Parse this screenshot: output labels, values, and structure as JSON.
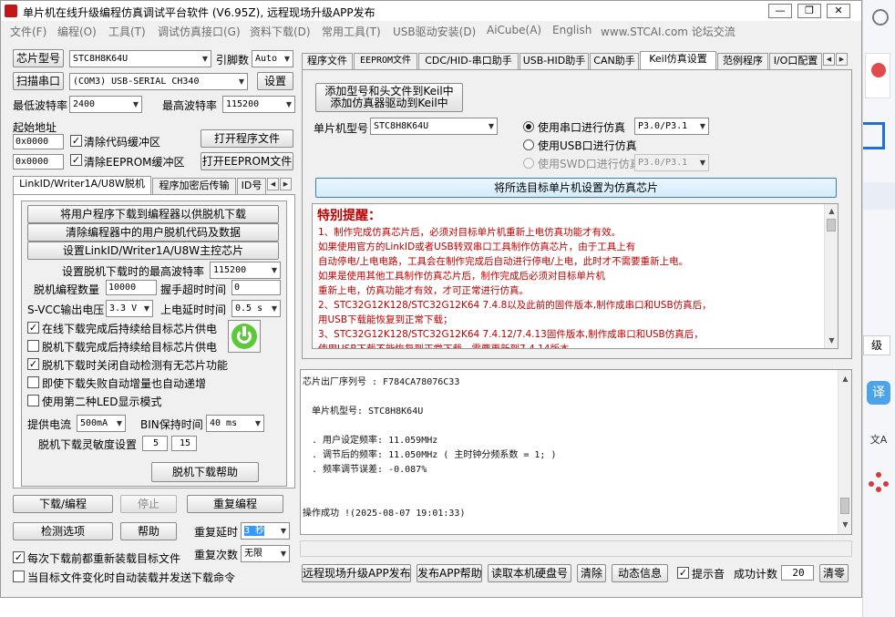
{
  "window": {
    "title": "单片机在线升级编程仿真调试平台软件 (V6.95Z), 远程现场升级APP发布",
    "controls": [
      "—",
      "❐",
      "✕"
    ]
  },
  "menu": [
    "文件(F)",
    "编程(O)",
    "工具(T)",
    "调试仿真接口(G)",
    "资料下载(D)",
    "常用工具(T)",
    "USB驱动安装(D)",
    "AiCube(A)",
    "English",
    "www.STCAI.com 论坛交流"
  ],
  "left": {
    "mcu_type_btn": "芯片型号",
    "mcu_type_value": "STC8H8K64U",
    "pins_label": "引脚数",
    "pins_value": "Auto",
    "scan_port_btn": "扫描串口",
    "port_value": "(COM3) USB-SERIAL CH340",
    "settings_btn": "设置",
    "min_baud_label": "最低波特率",
    "min_baud_value": "2400",
    "max_baud_label": "最高波特率",
    "max_baud_value": "115200",
    "start_addr_label": "起始地址",
    "addr1": "0x0000",
    "clear_code_label": "清除代码缓冲区",
    "open_program_btn": "打开程序文件",
    "addr2": "0x0000",
    "clear_eeprom_label": "清除EEPROM缓冲区",
    "open_eeprom_btn": "打开EEPROM文件",
    "tabs": [
      "LinkID/Writer1A/U8W脱机",
      "程序加密后传输",
      "ID号"
    ],
    "offline": {
      "btn1": "将用户程序下载到编程器以供脱机下载",
      "btn2": "清除编程器中的用户脱机代码及数据",
      "btn3": "设置LinkID/Writer1A/U8W主控芯片",
      "max_baud_label": "设置脱机下载时的最高波特率",
      "max_baud_value": "115200",
      "count_label": "脱机编程数量",
      "count_value": "10000",
      "handshake_label": "握手超时时间",
      "handshake_value": "0",
      "svcc_label": "S-VCC输出电压",
      "svcc_value": "3.3 V",
      "power_delay_label": "上电延时时间",
      "power_delay_value": "0.5 s",
      "chk1": "在线下载完成后持续给目标芯片供电",
      "chk2": "脱机下载完成后持续给目标芯片供电",
      "chk3": "脱机下载时关闭自动检测有无芯片功能",
      "chk4": "即使下载失败自动增量也自动递增",
      "chk5": "使用第二种LED显示模式",
      "current_label": "提供电流",
      "current_value": "500mA",
      "bin_hold_label": "BIN保持时间",
      "bin_hold_value": "40 ms",
      "sensitivity_label": "脱机下载灵敏度设置",
      "sens1": "5",
      "sens2": "15",
      "help_btn": "脱机下载帮助"
    },
    "download_btn": "下载/编程",
    "stop_btn": "停止",
    "reprogram_btn": "重复编程",
    "check_btn": "检测选项",
    "help_btn": "帮助",
    "repeat_delay_label": "重复延时",
    "repeat_delay_value": "3 秒",
    "repeat_count_label": "重复次数",
    "repeat_count_value": "无限",
    "reload_label": "每次下载前都重新装载目标文件",
    "auto_reload_label": "当目标文件变化时自动装载并发送下载命令"
  },
  "right": {
    "tabs": [
      "程序文件",
      "EEPROM文件",
      "CDC/HID-串口助手",
      "USB-HID助手",
      "CAN助手",
      "Keil仿真设置",
      "范例程序",
      "I/O口配置"
    ],
    "keil": {
      "add_btn_line1": "添加型号和头文件到Keil中",
      "add_btn_line2": "添加仿真器驱动到Keil中",
      "mcu_label": "单片机型号",
      "mcu_value": "STC8H8K64U",
      "opt_serial": "使用串口进行仿真",
      "opt_serial_port": "P3.0/P3.1",
      "opt_usb": "使用USB口进行仿真",
      "opt_swd": "使用SWD口进行仿真",
      "opt_swd_port": "P3.0/P3.1",
      "set_chip_btn": "将所选目标单片机设置为仿真芯片"
    },
    "notice_title": "特别提醒：",
    "notice_lines": [
      "1、制作完成仿真芯片后，必须对目标单片机重新上电仿真功能才有效。",
      "    如果使用官方的LinkID或者USB转双串口工具制作仿真芯片，由于工具上有",
      "    自动停电/上电电路，工具会在制作完成后自动进行停电/上电，此时才不需要重新上电。",
      "    如果是使用其他工具制作仿真芯片后，制作完成后必须对目标单片机",
      "    重新上电，仿真功能才有效，才可正常进行仿真。",
      "2、STC32G12K128/STC32G12K64  7.4.8以及此前的固件版本,制作成串口和USB仿真后，",
      "    用USB下载能恢复到正常下载；",
      "3、STC32G12K128/STC32G12K64  7.4.12/7.4.13固件版本,制作成串口和USB仿真后，",
      "    使用USB下载不能恢复到正常下载，需要更新到7.4.14版本"
    ],
    "output": {
      "serial": "芯片出厂序列号 : F784CA78076C33",
      "mcu": "单片机型号: STC8H8K64U",
      "freq_set": ". 用户设定频率: 11.059MHz",
      "freq_adj": ". 调节后的频率: 11.050MHz ( 主时钟分频系数 = 1; )",
      "freq_err": ". 频率调节误差: -0.087%",
      "success": "操作成功 !(2025-08-07 19:01:33)"
    },
    "bottom": {
      "publish_btn": "远程现场升级APP发布",
      "publish_help_btn": "发布APP帮助",
      "read_disk_btn": "读取本机硬盘号",
      "clear_btn": "清除",
      "dynamic_btn": "动态信息",
      "beep_label": "提示音",
      "success_count_label": "成功计数",
      "success_count_value": "20",
      "reset_btn": "清零"
    }
  },
  "side": {
    "level_text": "级",
    "translate": "译",
    "ai": "文A"
  }
}
